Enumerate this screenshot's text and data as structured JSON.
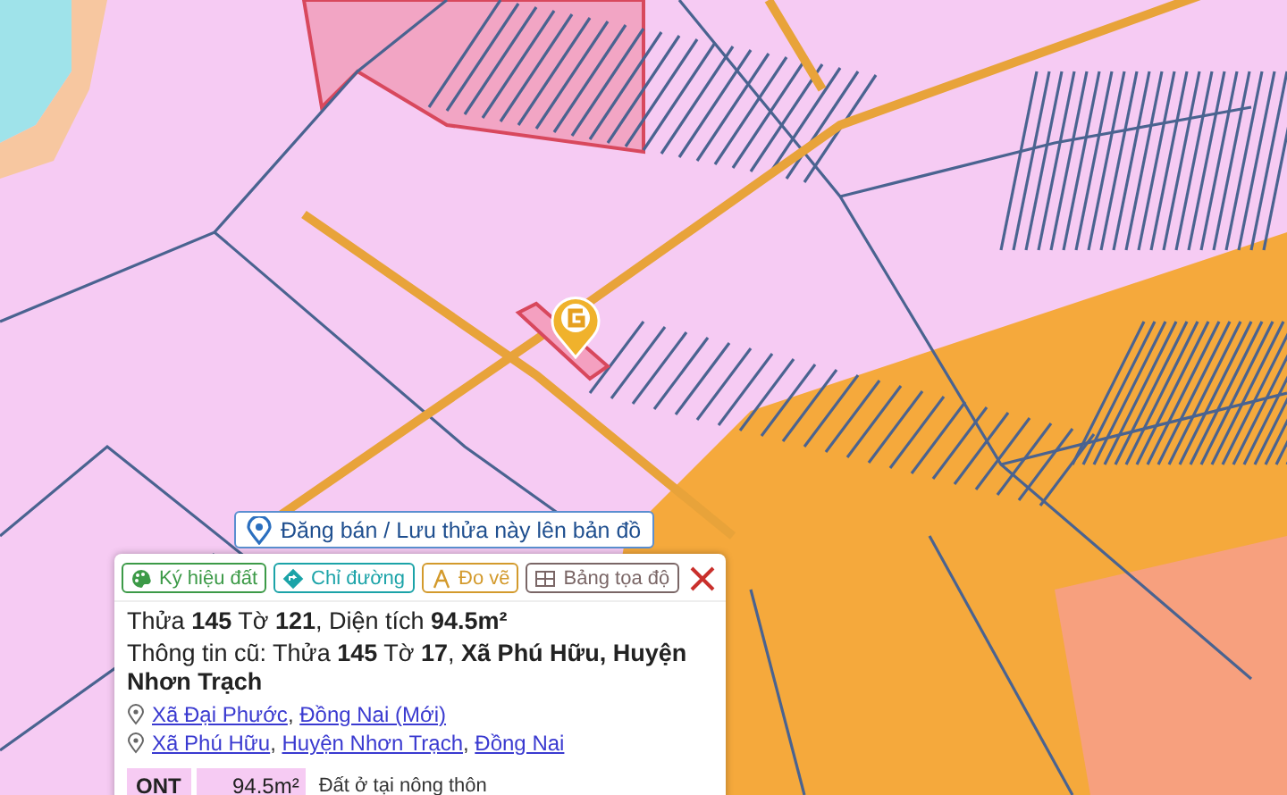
{
  "post_button": {
    "label": "Đăng bán / Lưu thửa này lên bản đồ"
  },
  "popup": {
    "actions": [
      {
        "kind": "palette",
        "label": "Ký hiệu đất",
        "color": "#3c9a47"
      },
      {
        "kind": "direction",
        "label": "Chỉ đường",
        "color": "#1ba3a8"
      },
      {
        "kind": "measure",
        "label": "Đo vẽ",
        "color": "#d39a2c"
      },
      {
        "kind": "table",
        "label": "Bảng tọa độ",
        "color": "#7a6666"
      }
    ],
    "title": "Thửa **145** Tờ **121**, Diện tích **94.5m²**",
    "old_info": "Thông tin cũ: Thửa **145** Tờ **17**, **Xã Phú Hữu, Huyện Nhơn Trạch**",
    "separator": ", ",
    "addresses": [
      {
        "parts": [
          "Xã Đại Phước",
          "Đồng Nai (Mới)"
        ]
      },
      {
        "parts": [
          "Xã Phú Hữu",
          "Huyện Nhơn Trạch",
          "Đồng Nai"
        ]
      }
    ],
    "land_uses": [
      {
        "code": "ONT",
        "area": "94.5m²",
        "description": "Đất ở tại nông thôn"
      }
    ]
  }
}
